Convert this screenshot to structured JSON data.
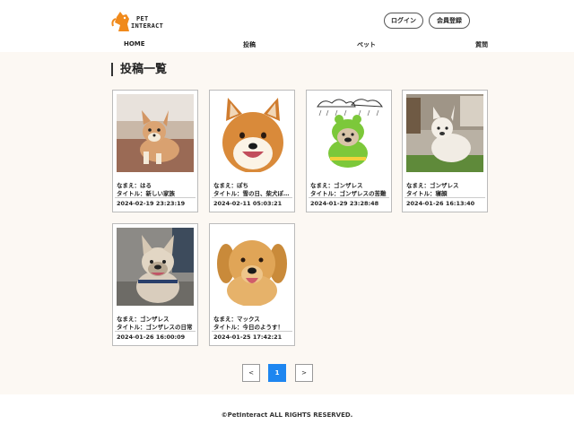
{
  "header": {
    "logo_line1": "PET",
    "logo_line2": "INTERACT",
    "login_label": "ログイン",
    "register_label": "会員登録"
  },
  "nav": {
    "home": "HOME",
    "posts": "投稿",
    "pets": "ペット",
    "questions": "質問"
  },
  "main": {
    "title": "投稿一覧",
    "posts": [
      {
        "name": "なまえ：はる",
        "title": "タイトル：新しい家族",
        "date": "2024-02-19 23:23:19",
        "image": "chihuahua-photo"
      },
      {
        "name": "なまえ：ぽち",
        "title": "タイトル：雪の日、柴犬ぽち…",
        "date": "2024-02-11 05:03:21",
        "image": "shiba-photo"
      },
      {
        "name": "なまえ：ゴンザレス",
        "title": "タイトル：ゴンザレスの苦難",
        "date": "2024-01-29 23:28:48",
        "image": "frog-costume-bulldog-photo"
      },
      {
        "name": "なまえ：ゴンザレス",
        "title": "タイトル：寝顔",
        "date": "2024-01-26 16:13:40",
        "image": "french-bulldog-room-photo"
      },
      {
        "name": "なまえ：ゴンザレス",
        "title": "タイトル：ゴンザレスの日常",
        "date": "2024-01-26 16:00:09",
        "image": "french-bulldog-walk-photo"
      },
      {
        "name": "なまえ：マックス",
        "title": "タイトル：今日のようす！",
        "date": "2024-01-25 17:42:21",
        "image": "golden-retriever-photo"
      }
    ]
  },
  "pagination": {
    "prev": "<",
    "current": "1",
    "next": ">"
  },
  "footer": {
    "copyright": "©PetInteract ALL RIGHTS RESERVED."
  },
  "colors": {
    "accent": "#1e86f0",
    "main_bg": "#fcf8f3",
    "logo_orange": "#f08a1c"
  }
}
